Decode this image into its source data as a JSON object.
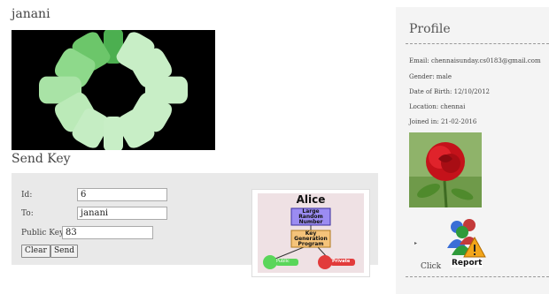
{
  "header": {
    "username": "janani"
  },
  "send_key": {
    "title": "Send Key",
    "id_label": "Id:",
    "id_value": "6",
    "to_label": "To:",
    "to_value": "janani",
    "pubkey_label": "Public Key:",
    "pubkey_value": "83",
    "clear_label": "Clear",
    "send_label": "Send"
  },
  "diagram": {
    "title": "Alice",
    "box1": [
      "Large",
      "Random",
      "Number"
    ],
    "box2": [
      "Key",
      "Generation",
      "Program"
    ],
    "public_label": "Public",
    "private_label": "Private"
  },
  "profile": {
    "title": "Profile",
    "email": "Email:  chennaisunday.cs0183@gmail.com",
    "gender": "Gender:  male",
    "dob": "Date of Birth:  12/10/2012",
    "location": "Location:  chennai",
    "joined": "Joined in:  21-02-2016",
    "report_label": "Report",
    "click_text": "Click"
  },
  "colors": {
    "spinner_green": "#4caf50",
    "spinner_light": "#c8eec6",
    "panel_bg": "#e9e9e9"
  }
}
